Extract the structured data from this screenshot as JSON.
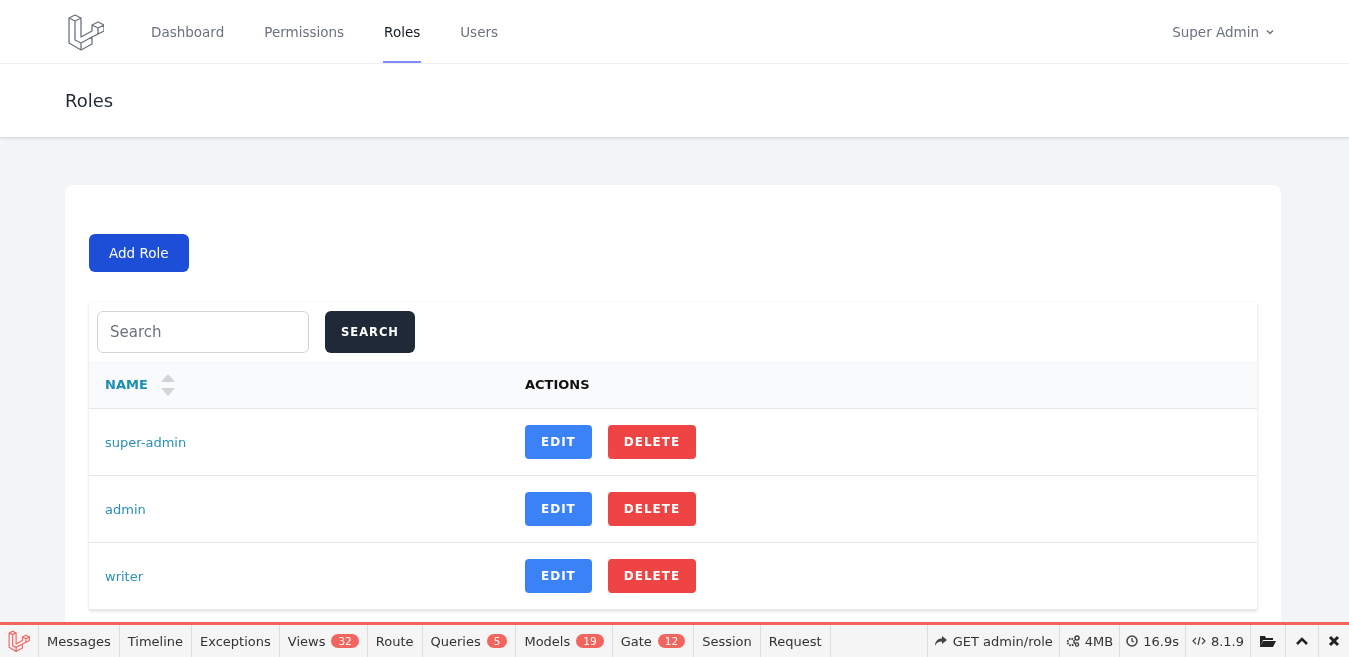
{
  "nav": {
    "links": [
      {
        "label": "Dashboard",
        "selected": false
      },
      {
        "label": "Permissions",
        "selected": false
      },
      {
        "label": "Roles",
        "selected": true
      },
      {
        "label": "Users",
        "selected": false
      }
    ],
    "user": "Super Admin"
  },
  "header": {
    "title": "Roles"
  },
  "add_button": "Add Role",
  "search": {
    "placeholder": "Search",
    "button": "SEARCH"
  },
  "table": {
    "columns": [
      "NAME",
      "ACTIONS"
    ],
    "rows": [
      {
        "name": "super-admin",
        "edit": "EDIT",
        "delete": "DELETE"
      },
      {
        "name": "admin",
        "edit": "EDIT",
        "delete": "DELETE"
      },
      {
        "name": "writer",
        "edit": "EDIT",
        "delete": "DELETE"
      }
    ]
  },
  "debugbar": {
    "tabs": [
      {
        "label": "Messages"
      },
      {
        "label": "Timeline"
      },
      {
        "label": "Exceptions"
      },
      {
        "label": "Views",
        "badge": "32"
      },
      {
        "label": "Route"
      },
      {
        "label": "Queries",
        "badge": "5"
      },
      {
        "label": "Models",
        "badge": "19"
      },
      {
        "label": "Gate",
        "badge": "12"
      },
      {
        "label": "Session"
      },
      {
        "label": "Request"
      }
    ],
    "stats": [
      {
        "kind": "request",
        "text": "GET admin/role"
      },
      {
        "kind": "memory",
        "text": "4MB"
      },
      {
        "kind": "time",
        "text": "16.9s"
      },
      {
        "kind": "version",
        "text": "8.1.9"
      }
    ]
  }
}
